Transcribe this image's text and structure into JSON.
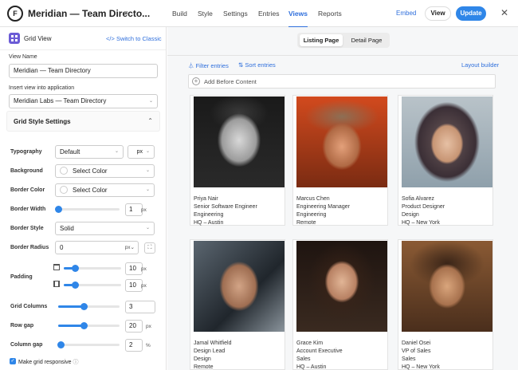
{
  "app": {
    "title": "Meridian — Team Directo...",
    "logo": "F"
  },
  "nav": [
    "Build",
    "Style",
    "Settings",
    "Entries",
    "Views",
    "Reports"
  ],
  "actions": {
    "embed": "Embed",
    "view": "View",
    "update": "Update"
  },
  "sidebar": {
    "header": {
      "label": "Grid View",
      "switch": "Switch to Classic"
    },
    "view_name": {
      "label": "View Name",
      "value": "Meridian — Team Directory"
    },
    "app_field": {
      "label": "Insert view into application",
      "value": "Meridian Labs — Team Directory"
    },
    "section": "Grid Style Settings",
    "settings": {
      "typography": {
        "label": "Typography",
        "value": "Default",
        "unit": "px"
      },
      "background": {
        "label": "Background",
        "value": "Select Color"
      },
      "border_color": {
        "label": "Border Color",
        "value": "Select Color"
      },
      "border_width": {
        "label": "Border Width",
        "value": "1",
        "unit": "px",
        "level": 0.0
      },
      "border_style": {
        "label": "Border Style",
        "value": "Solid"
      },
      "border_radius": {
        "label": "Border Radius",
        "value": "0",
        "unit": "px"
      },
      "padding": {
        "label": "Padding",
        "top": "10",
        "side": "10",
        "unit": "px",
        "level_top": 0.2,
        "level_side": 0.2
      },
      "grid_columns": {
        "label": "Grid Columns",
        "value": "3",
        "level": 0.42
      },
      "row_gap": {
        "label": "Row gap",
        "value": "20",
        "unit": "px",
        "level": 0.42
      },
      "column_gap": {
        "label": "Column gap",
        "value": "2",
        "unit": "%",
        "level": 0.04
      }
    },
    "responsive": "Make grid responsive"
  },
  "canvas": {
    "tabs": [
      "Listing Page",
      "Detail Page"
    ],
    "filter": "Filter entries",
    "sort": "Sort entries",
    "layout_builder": "Layout builder",
    "add_before": "Add Before Content",
    "cards": [
      {
        "lines": [
          "Priya Nair",
          "Senior Software Engineer",
          "Engineering",
          "HQ – Austin"
        ],
        "photo": "bw"
      },
      {
        "lines": [
          "Marcus Chen",
          "Engineering Manager",
          "Engineering",
          "Remote"
        ],
        "photo": "warm"
      },
      {
        "lines": [
          "Sofia Alvarez",
          "Product Designer",
          "Design",
          "HQ – New York"
        ],
        "photo": "scarf"
      },
      {
        "lines": [
          "Jamal Whitfield",
          "Design Lead",
          "Design",
          "Remote"
        ],
        "photo": "car"
      },
      {
        "lines": [
          "Grace Kim",
          "Account Executive",
          "Sales",
          "HQ – Austin"
        ],
        "photo": "dark"
      },
      {
        "lines": [
          "Daniel Osei",
          "VP of Sales",
          "Sales",
          "HQ – New York"
        ],
        "photo": "sepia"
      }
    ]
  },
  "colors": {
    "accent": "#2f86e8",
    "link": "#2f6fdc",
    "grid_icon": "#6b5bd6"
  }
}
